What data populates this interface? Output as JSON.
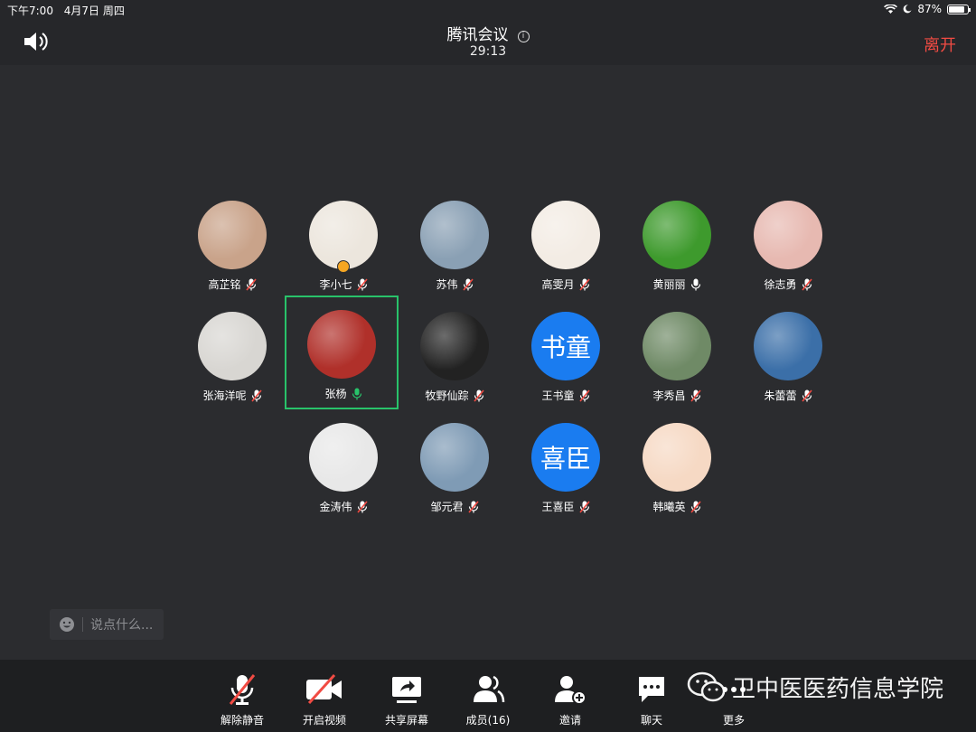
{
  "status": {
    "time": "下午7:00",
    "date": "4月7日 周四",
    "battery": "87%",
    "battery_level": 0.87
  },
  "header": {
    "title": "腾讯会议",
    "info_icon": "i",
    "timer": "29:13",
    "leave_label": "离开"
  },
  "participants": [
    {
      "name": "高芷铭",
      "avatar": "photo",
      "mic": "muted",
      "color": "#c9a38a"
    },
    {
      "name": "李小七",
      "avatar": "photo",
      "mic": "muted",
      "color": "#ece6dd",
      "host": true
    },
    {
      "name": "苏伟",
      "avatar": "photo",
      "mic": "muted",
      "color": "#8aa0b4"
    },
    {
      "name": "高雯月",
      "avatar": "photo",
      "mic": "muted",
      "color": "#f3ece4"
    },
    {
      "name": "黄丽丽",
      "avatar": "photo",
      "mic": "on",
      "color": "#3e9a2d"
    },
    {
      "name": "徐志勇",
      "avatar": "photo",
      "mic": "muted",
      "color": "#e7b9b1"
    },
    {
      "name": "张海洋呢",
      "avatar": "photo",
      "mic": "muted",
      "color": "#d8d6d2"
    },
    {
      "name": "张杨",
      "avatar": "photo",
      "mic": "speaking",
      "color": "#b0302a",
      "active": true
    },
    {
      "name": "牧野仙踪",
      "avatar": "photo",
      "mic": "muted",
      "color": "#222222"
    },
    {
      "name": "王书童",
      "avatar": "text",
      "avatar_text": "书童",
      "mic": "muted"
    },
    {
      "name": "李秀昌",
      "avatar": "photo",
      "mic": "muted",
      "color": "#6f8a66"
    },
    {
      "name": "朱蕾蕾",
      "avatar": "photo",
      "mic": "muted",
      "color": "#3b6fa8"
    },
    {
      "name": "金涛伟",
      "avatar": "photo",
      "mic": "muted",
      "color": "#e8e8e8"
    },
    {
      "name": "邹元君",
      "avatar": "photo",
      "mic": "muted",
      "color": "#7f9bb5"
    },
    {
      "name": "王喜臣",
      "avatar": "text",
      "avatar_text": "喜臣",
      "mic": "muted"
    },
    {
      "name": "韩曦英",
      "avatar": "photo",
      "mic": "muted",
      "color": "#f6d9c4"
    }
  ],
  "chat": {
    "placeholder": "说点什么..."
  },
  "toolbar": {
    "unmute": "解除静音",
    "video": "开启视频",
    "share": "共享屏幕",
    "members": "成员(16)",
    "invite": "邀请",
    "chat": "聊天",
    "more": "更多"
  },
  "watermark": {
    "text": "卫中医医药信息学院"
  },
  "colors": {
    "accent_green": "#28c36a",
    "leave_red": "#f14b43",
    "text_avatar_blue": "#1a7cf0"
  }
}
